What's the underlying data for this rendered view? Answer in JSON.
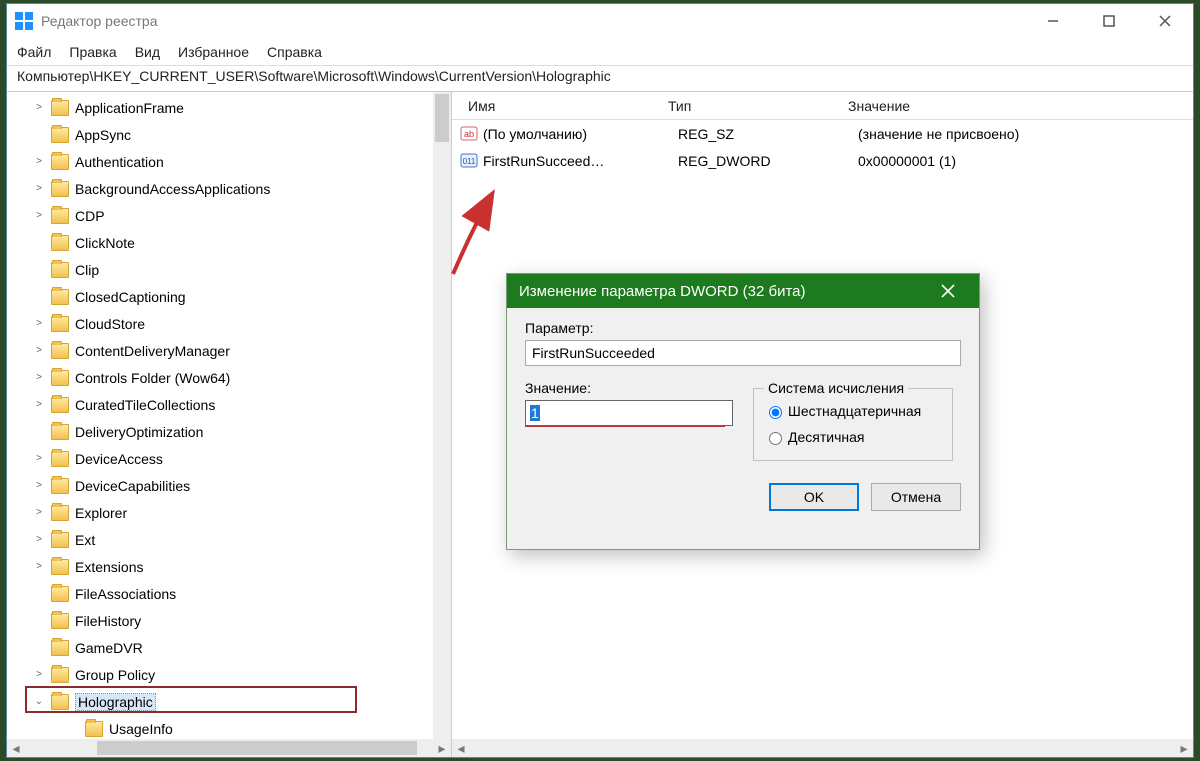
{
  "window": {
    "title": "Редактор реестра",
    "menu": [
      "Файл",
      "Правка",
      "Вид",
      "Избранное",
      "Справка"
    ],
    "address": "Компьютер\\HKEY_CURRENT_USER\\Software\\Microsoft\\Windows\\CurrentVersion\\Holographic"
  },
  "tree": [
    {
      "label": "ApplicationFrame",
      "exp": ">"
    },
    {
      "label": "AppSync"
    },
    {
      "label": "Authentication",
      "exp": ">"
    },
    {
      "label": "BackgroundAccessApplications",
      "exp": ">"
    },
    {
      "label": "CDP",
      "exp": ">"
    },
    {
      "label": "ClickNote"
    },
    {
      "label": "Clip"
    },
    {
      "label": "ClosedCaptioning"
    },
    {
      "label": "CloudStore",
      "exp": ">"
    },
    {
      "label": "ContentDeliveryManager",
      "exp": ">"
    },
    {
      "label": "Controls Folder (Wow64)",
      "exp": ">"
    },
    {
      "label": "CuratedTileCollections",
      "exp": ">"
    },
    {
      "label": "DeliveryOptimization"
    },
    {
      "label": "DeviceAccess",
      "exp": ">"
    },
    {
      "label": "DeviceCapabilities",
      "exp": ">"
    },
    {
      "label": "Explorer",
      "exp": ">"
    },
    {
      "label": "Ext",
      "exp": ">"
    },
    {
      "label": "Extensions",
      "exp": ">"
    },
    {
      "label": "FileAssociations"
    },
    {
      "label": "FileHistory"
    },
    {
      "label": "GameDVR"
    },
    {
      "label": "Group Policy",
      "exp": ">"
    },
    {
      "label": "Holographic",
      "exp": "v",
      "selected": true,
      "highlight": true
    },
    {
      "label": "UsageInfo",
      "child": true
    }
  ],
  "list": {
    "columns": {
      "name": "Имя",
      "type": "Тип",
      "value": "Значение"
    },
    "rows": [
      {
        "icon": "sz",
        "name": "(По умолчанию)",
        "type": "REG_SZ",
        "value": "(значение не присвоено)"
      },
      {
        "icon": "dw",
        "name": "FirstRunSucceed…",
        "type": "REG_DWORD",
        "value": "0x00000001 (1)"
      }
    ]
  },
  "dialog": {
    "title": "Изменение параметра DWORD (32 бита)",
    "param_label": "Параметр:",
    "param_value": "FirstRunSucceeded",
    "value_label": "Значение:",
    "value_input": "1",
    "base_label": "Система исчисления",
    "radio_hex": "Шестнадцатеричная",
    "radio_dec": "Десятичная",
    "ok": "OK",
    "cancel": "Отмена"
  }
}
